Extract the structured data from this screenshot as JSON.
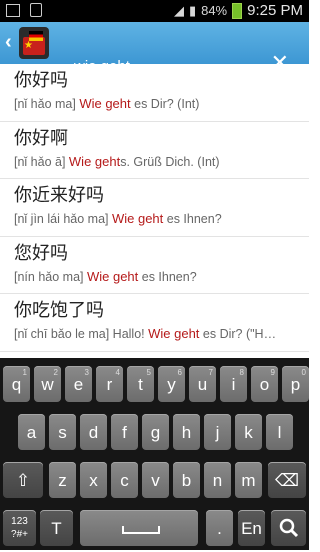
{
  "status": {
    "time": "9:25 PM",
    "battery": "84%"
  },
  "search": {
    "value": "wie geht"
  },
  "results": [
    {
      "zh": "你好吗",
      "pre": "[nǐ hǎo ma] ",
      "hl": "Wie geht",
      "post": " es Dir? (Int)"
    },
    {
      "zh": "你好啊",
      "pre": "[nǐ hǎo ā] ",
      "hl": "Wie geht",
      "post": "s. Grüß Dich. (Int)"
    },
    {
      "zh": "你近来好吗",
      "pre": "[nǐ jìn lái hǎo ma] ",
      "hl": "Wie geht",
      "post": " es Ihnen?"
    },
    {
      "zh": "您好吗",
      "pre": "[nín hǎo ma] ",
      "hl": "Wie geht",
      "post": " es Ihnen?"
    },
    {
      "zh": "你吃饱了吗",
      "pre": "[nǐ chī bǎo le ma] Hallo! ",
      "hl": "Wie geht",
      "post": " es Dir? (\"H…"
    }
  ],
  "keyboard": {
    "row1": [
      {
        "k": "q",
        "s": "1"
      },
      {
        "k": "w",
        "s": "2"
      },
      {
        "k": "e",
        "s": "3"
      },
      {
        "k": "r",
        "s": "4"
      },
      {
        "k": "t",
        "s": "5"
      },
      {
        "k": "y",
        "s": "6"
      },
      {
        "k": "u",
        "s": "7"
      },
      {
        "k": "i",
        "s": "8"
      },
      {
        "k": "o",
        "s": "9"
      },
      {
        "k": "p",
        "s": "0"
      }
    ],
    "row2": [
      "a",
      "s",
      "d",
      "f",
      "g",
      "h",
      "j",
      "k",
      "l"
    ],
    "row3": [
      "z",
      "x",
      "c",
      "v",
      "b",
      "n",
      "m"
    ],
    "shift": "⇧",
    "backspace": "⌫",
    "sym": "123\n?#+",
    "text_tool": "T",
    "period": ".",
    "lang": "En",
    "search_icon": "search-icon"
  }
}
